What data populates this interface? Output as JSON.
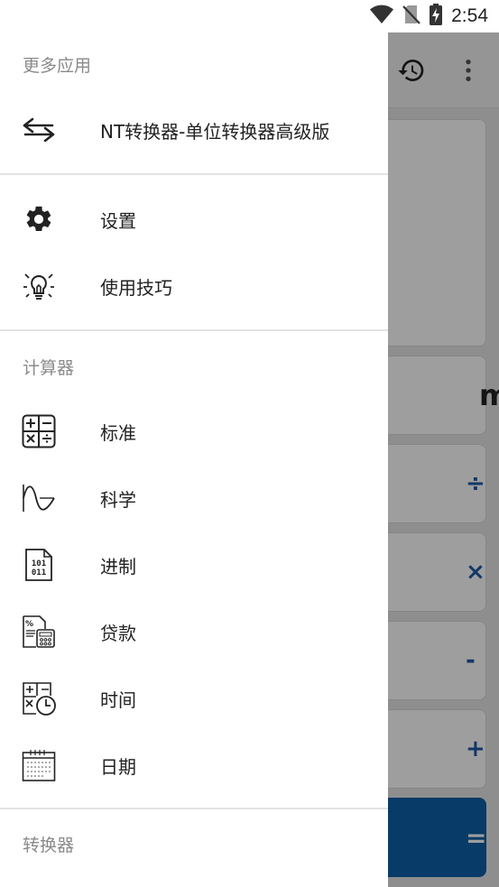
{
  "status_bar": {
    "time": "2:54"
  },
  "drawer": {
    "more_apps": {
      "header": "更多应用",
      "items": [
        {
          "label": "NT转换器-单位转换器高级版",
          "icon": "swap-arrows-icon"
        }
      ]
    },
    "general": {
      "items": [
        {
          "label": "设置",
          "icon": "gear-icon"
        },
        {
          "label": "使用技巧",
          "icon": "lightbulb-icon"
        }
      ]
    },
    "calculators": {
      "header": "计算器",
      "items": [
        {
          "label": "标准",
          "icon": "standard-calculator-icon"
        },
        {
          "label": "科学",
          "icon": "sine-wave-icon"
        },
        {
          "label": "进制",
          "icon": "binary-document-icon"
        },
        {
          "label": "贷款",
          "icon": "loan-calculator-icon"
        },
        {
          "label": "时间",
          "icon": "time-calculator-icon"
        },
        {
          "label": "日期",
          "icon": "calendar-icon"
        }
      ]
    },
    "converters": {
      "header": "转换器"
    }
  },
  "background_app": {
    "keys": {
      "mr": "mr",
      "divide": "÷",
      "multiply": "×",
      "minus": "-",
      "plus": "+",
      "equals": "="
    },
    "accent_color": "#0d5fa6"
  }
}
